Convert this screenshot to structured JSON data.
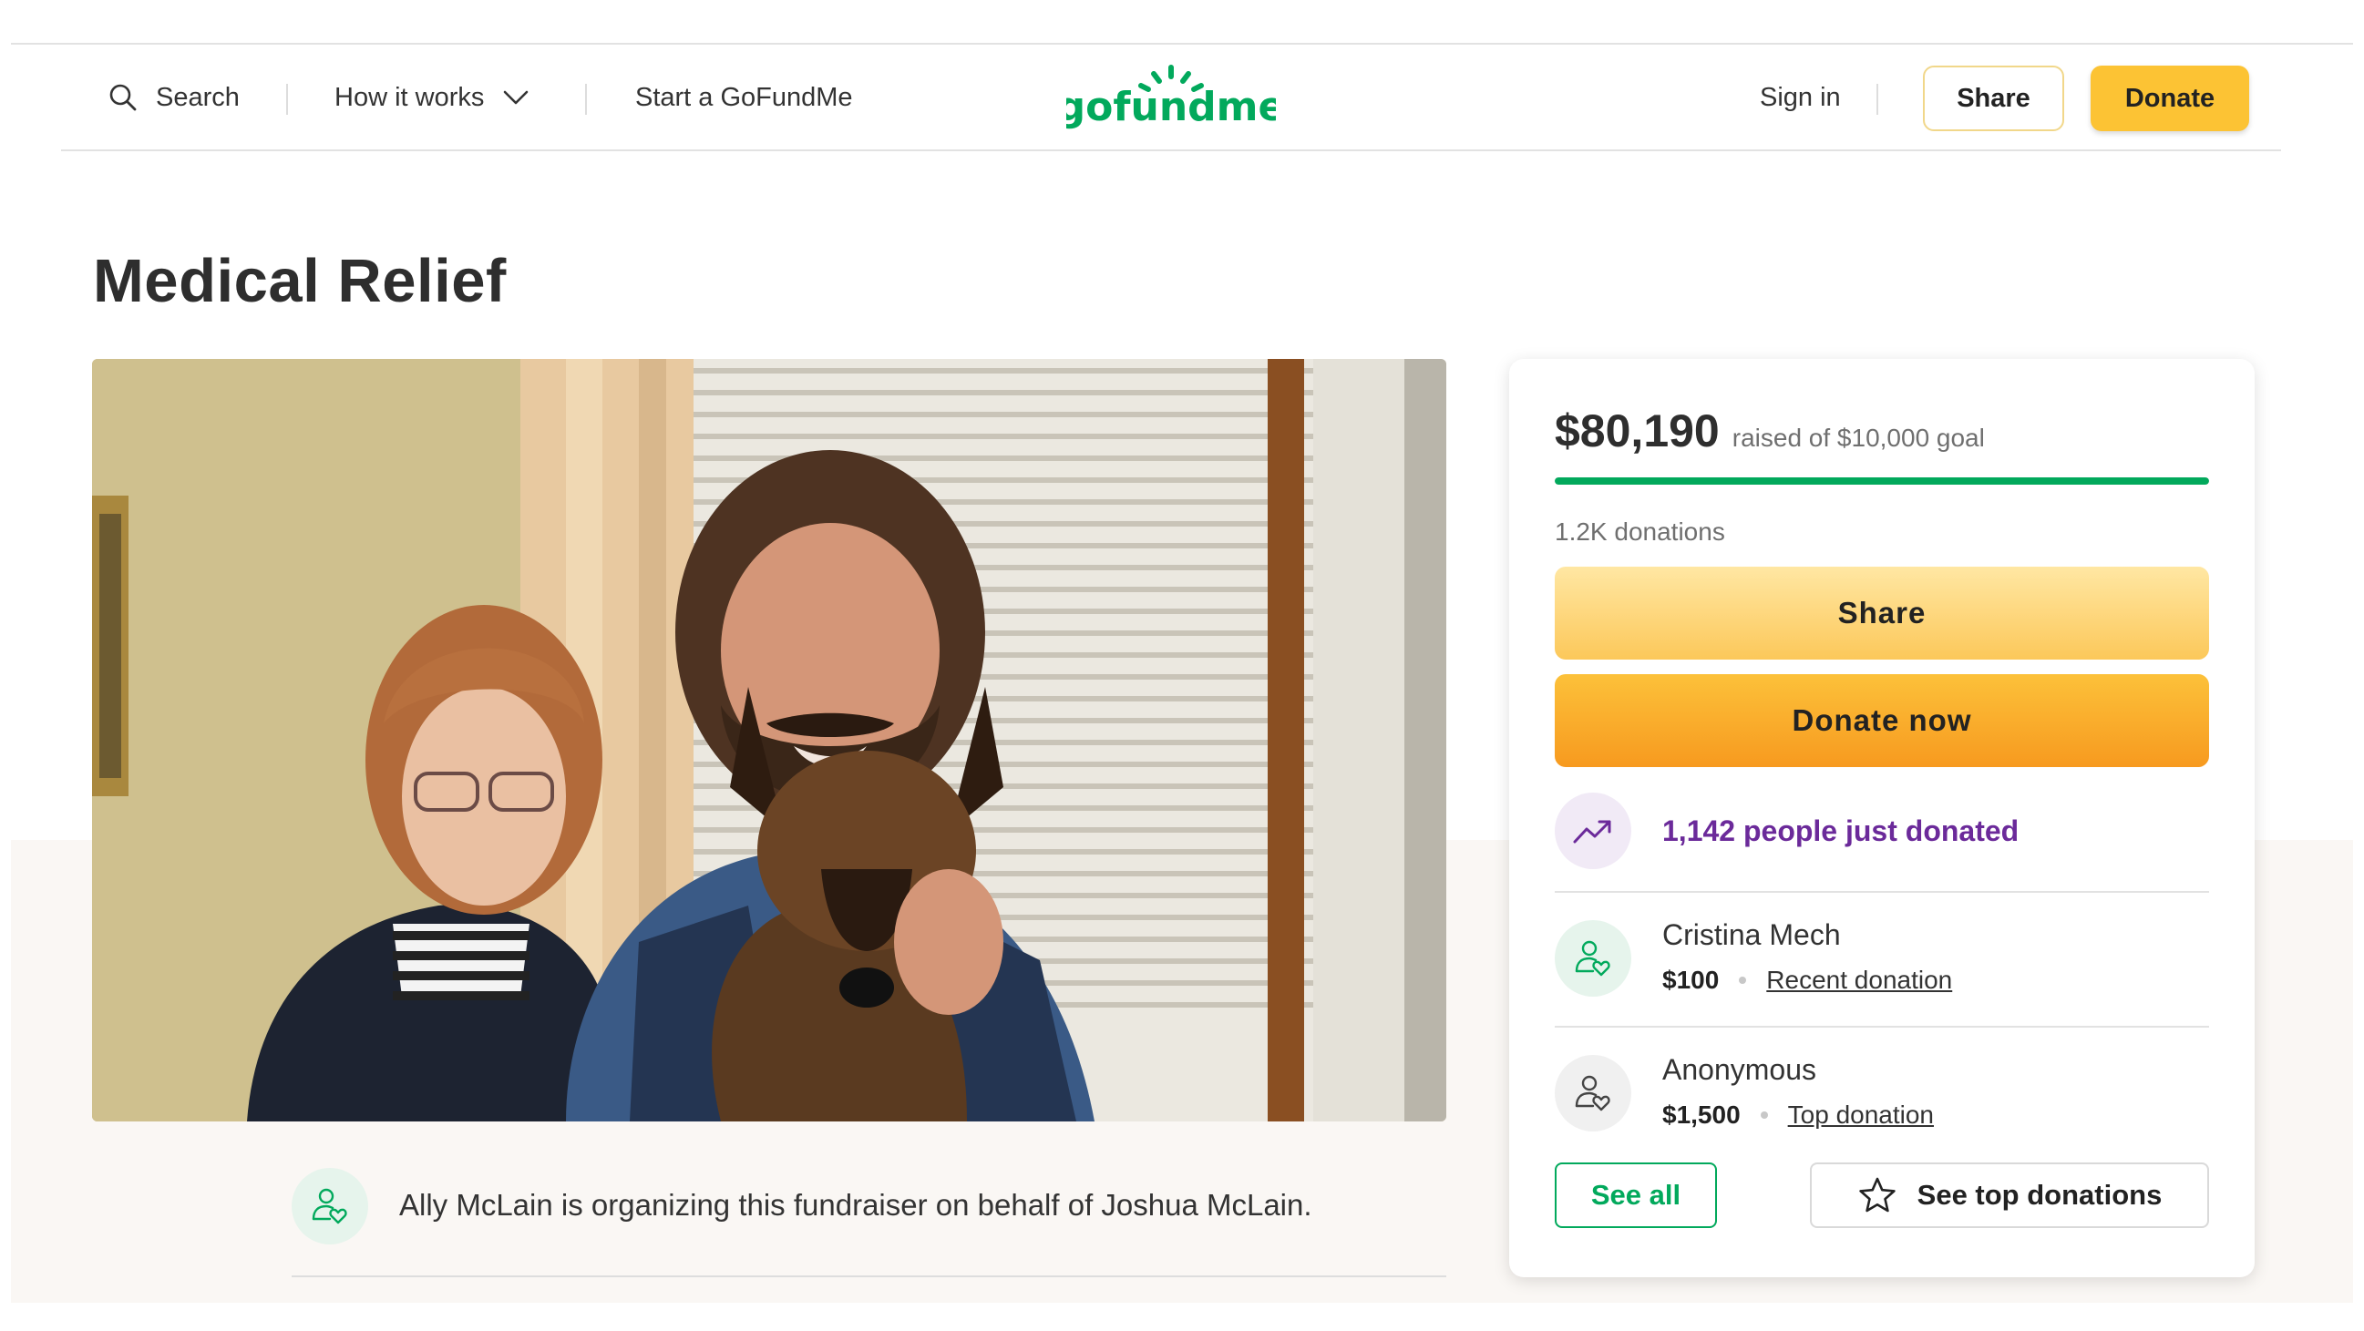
{
  "header": {
    "search_label": "Search",
    "how_label": "How it works",
    "start_label": "Start a GoFundMe",
    "logo_text": "gofundme",
    "signin_label": "Sign in",
    "share_label": "Share",
    "donate_label": "Donate"
  },
  "page": {
    "title": "Medical Relief"
  },
  "organizer": {
    "text": "Ally McLain is organizing this fundraiser on behalf of Joshua McLain."
  },
  "card": {
    "raised_amount": "$80,190",
    "goal_text": "raised of $10,000 goal",
    "progress_fraction": 1.0,
    "donation_count": "1.2K donations",
    "share_label": "Share",
    "donate_now_label": "Donate now",
    "trend_text": "1,142 people just donated",
    "donors": [
      {
        "name": "Cristina Mech",
        "amount": "$100",
        "tag": "Recent donation"
      },
      {
        "name": "Anonymous",
        "amount": "$1,500",
        "tag": "Top donation"
      }
    ],
    "see_all_label": "See all",
    "see_top_label": "See top donations"
  },
  "colors": {
    "brand_green": "#02a95c",
    "donate_yellow": "#fcc334",
    "trend_purple": "#6b2a9a"
  },
  "icons": [
    "search-icon",
    "chevron-down-icon",
    "trend-up-icon",
    "donor-heart-icon",
    "star-icon"
  ]
}
